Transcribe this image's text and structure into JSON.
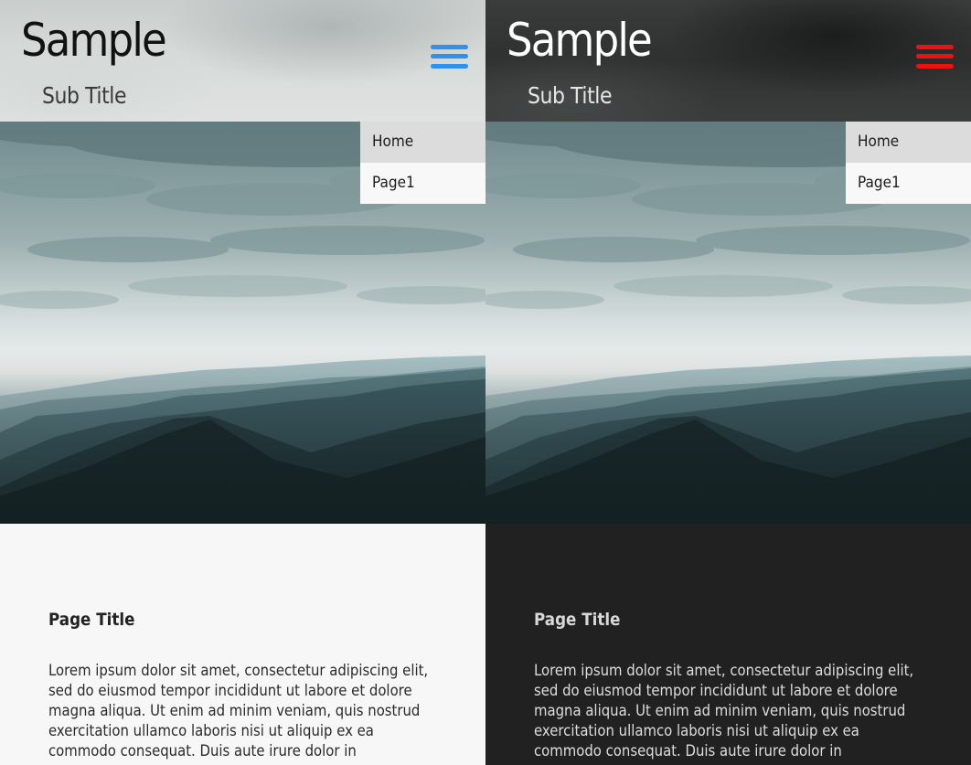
{
  "variants": [
    {
      "theme": "light",
      "header": {
        "title": "Sample",
        "subtitle": "Sub Title",
        "menu_icon": "hamburger-menu-icon",
        "menu_icon_color": "#2e91ef"
      },
      "nav_menu": {
        "items": [
          {
            "label": "Home",
            "active": true
          },
          {
            "label": "Page1",
            "active": false
          }
        ]
      },
      "content": {
        "page_title": "Page Title",
        "body": "Lorem ipsum dolor sit amet, consectetur adipiscing elit, sed do eiusmod tempor incididunt ut labore et dolore magna aliqua. Ut enim ad minim veniam, quis nostrud exercitation ullamco laboris nisi ut aliquip ex ea commodo consequat. Duis aute irure dolor in"
      },
      "colors": {
        "background": "#f7f7f7",
        "text": "#2a2a2a"
      }
    },
    {
      "theme": "dark",
      "header": {
        "title": "Sample",
        "subtitle": "Sub Title",
        "menu_icon": "hamburger-menu-icon",
        "menu_icon_color": "#ee1111"
      },
      "nav_menu": {
        "items": [
          {
            "label": "Home",
            "active": true
          },
          {
            "label": "Page1",
            "active": false
          }
        ]
      },
      "content": {
        "page_title": "Page Title",
        "body": "Lorem ipsum dolor sit amet, consectetur adipiscing elit, sed do eiusmod tempor incididunt ut labore et dolore magna aliqua. Ut enim ad minim veniam, quis nostrud exercitation ullamco laboris nisi ut aliquip ex ea commodo consequat. Duis aute irure dolor in"
      },
      "colors": {
        "background": "#212121",
        "text": "#dddddd"
      }
    }
  ]
}
